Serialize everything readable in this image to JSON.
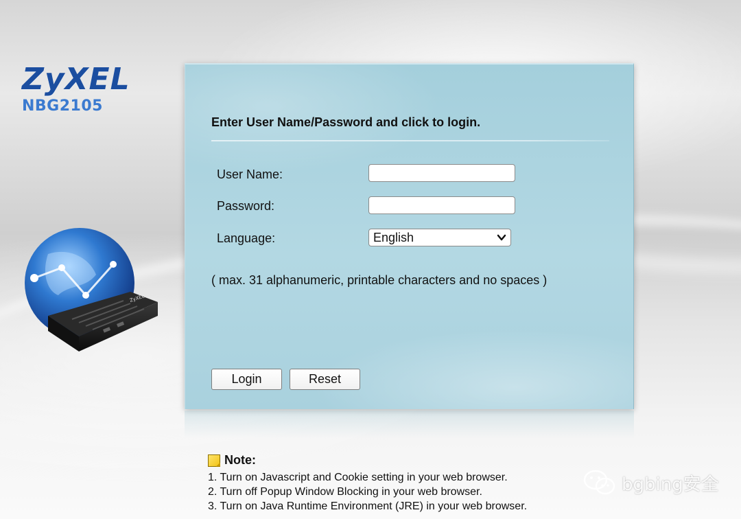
{
  "brand": {
    "logo_text": "ZyXEL",
    "model": "NBG2105",
    "brand_color": "#1b4ea0",
    "model_color": "#3a7ad0"
  },
  "illustration": {
    "icon": "globe-router-icon",
    "router_label": "ZyXEL"
  },
  "login_panel": {
    "heading": "Enter User Name/Password and click to login.",
    "username_label": "User Name:",
    "username_value": "",
    "password_label": "Password:",
    "password_value": "",
    "language_label": "Language:",
    "language_selected": "English",
    "hint": "( max. 31 alphanumeric, printable characters and no spaces )",
    "login_button": "Login",
    "reset_button": "Reset",
    "panel_color": "#a9d1de"
  },
  "note": {
    "title": "Note:",
    "lines": [
      "1. Turn on Javascript and Cookie setting in your web browser.",
      "2. Turn off Popup Window Blocking in your web browser.",
      "3. Turn on Java Runtime Environment (JRE) in your web browser."
    ]
  },
  "watermark": {
    "icon": "wechat-icon",
    "text": "bgbing安全"
  }
}
